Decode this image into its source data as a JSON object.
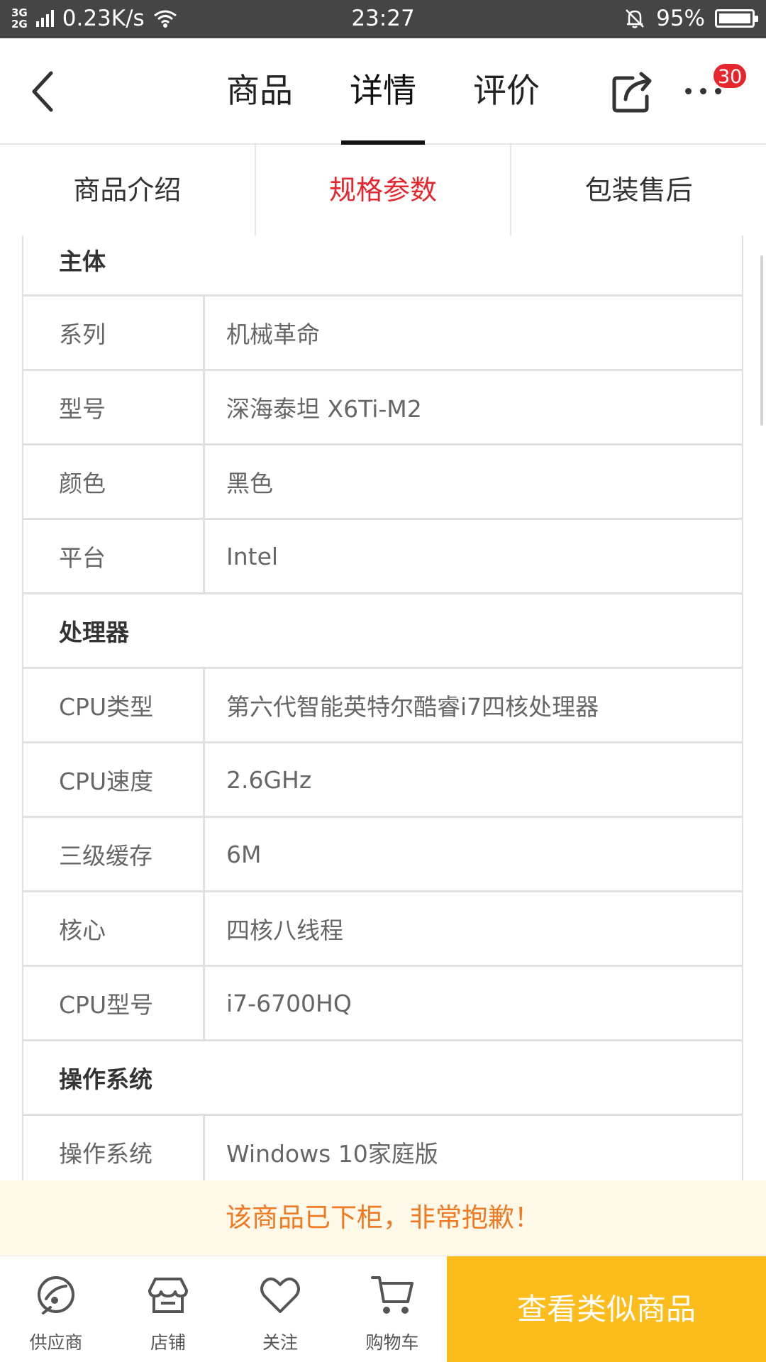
{
  "status_bar": {
    "network": "3G/2G",
    "speed": "0.23K/s",
    "time": "23:27",
    "battery": "95%"
  },
  "nav": {
    "tabs": [
      "商品",
      "详情",
      "评价"
    ],
    "active_tab": "详情",
    "cart_badge": "30"
  },
  "subtabs": {
    "items": [
      "商品介绍",
      "规格参数",
      "包装售后"
    ],
    "active": "规格参数"
  },
  "specs": [
    {
      "section": "主体",
      "rows": [
        {
          "key": "系列",
          "value": "机械革命"
        },
        {
          "key": "型号",
          "value": "深海泰坦 X6Ti-M2"
        },
        {
          "key": "颜色",
          "value": "黑色"
        },
        {
          "key": "平台",
          "value": "Intel"
        }
      ]
    },
    {
      "section": "处理器",
      "rows": [
        {
          "key": "CPU类型",
          "value": "第六代智能英特尔酷睿i7四核处理器"
        },
        {
          "key": "CPU速度",
          "value": "2.6GHz"
        },
        {
          "key": "三级缓存",
          "value": "6M"
        },
        {
          "key": "核心",
          "value": "四核八线程"
        },
        {
          "key": "CPU型号",
          "value": "i7-6700HQ"
        }
      ]
    },
    {
      "section": "操作系统",
      "rows": [
        {
          "key": "操作系统",
          "value": "Windows 10家庭版"
        }
      ]
    }
  ],
  "notice": "该商品已下柜，非常抱歉！",
  "bottom_bar": {
    "items": [
      "供应商",
      "店铺",
      "关注",
      "购物车"
    ],
    "similar_button": "查看类似商品"
  },
  "colors": {
    "accent_red": "#e5262c",
    "notice_text": "#f07a22",
    "notice_bg": "#fdf8e8",
    "similar_bg": "#fbbc1c"
  }
}
